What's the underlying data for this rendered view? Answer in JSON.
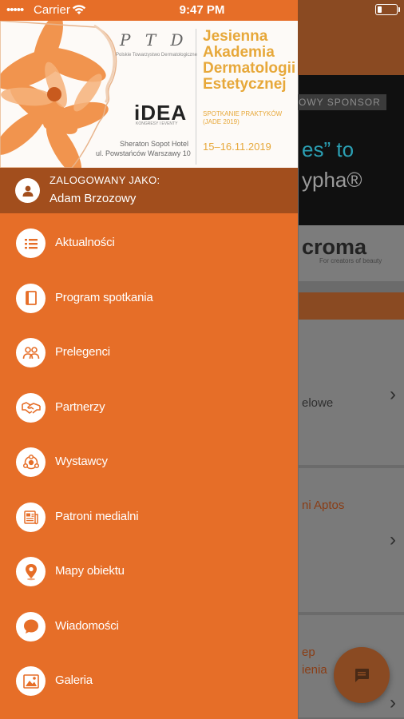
{
  "status_bar": {
    "carrier": "Carrier",
    "time": "9:47 PM",
    "icons": [
      "signal-dots-icon",
      "wifi-icon",
      "battery-icon"
    ]
  },
  "drawer": {
    "promo": {
      "logo_ptd": "P T D",
      "logo_ptd_sub": "Polskie Towarzystwo Dermatologiczne",
      "logo_idea": "iDEA",
      "logo_idea_sub": "KONGRESY I EVENTY",
      "venue_line1": "Sheraton Sopot Hotel",
      "venue_line2": "ul. Powstańców Warszawy 10",
      "event_title": [
        "Jesienna",
        "Akademia",
        "Dermatologii",
        "Estetycznej"
      ],
      "event_subtitle": "SPOTKANIE PRAKTYKÓW (JADE 2019)",
      "event_dates": "15–16.11.2019"
    },
    "user": {
      "label": "ZALOGOWANY JAKO:",
      "name": "Adam Brzozowy"
    },
    "menu": [
      {
        "label": "Aktualności",
        "icon": "list-icon"
      },
      {
        "label": "Program spotkania",
        "icon": "book-icon"
      },
      {
        "label": "Prelegenci",
        "icon": "people-icon"
      },
      {
        "label": "Partnerzy",
        "icon": "handshake-icon"
      },
      {
        "label": "Wystawcy",
        "icon": "network-icon"
      },
      {
        "label": "Patroni medialni",
        "icon": "newspaper-icon"
      },
      {
        "label": "Mapy obiektu",
        "icon": "map-pin-icon"
      },
      {
        "label": "Wiadomości",
        "icon": "chat-bubble-icon"
      },
      {
        "label": "Galeria",
        "icon": "image-icon"
      }
    ]
  },
  "background": {
    "sponsor_badge": "OWY SPONSOR",
    "banner_quote": "es” to",
    "banner_brand": "ypha®",
    "logo_text": "croma",
    "logo_sub": "For creators of beauty",
    "cards": [
      {
        "text": "elowe"
      },
      {
        "text": "ni Aptos"
      },
      {
        "text": "ep"
      },
      {
        "text": "ienia"
      }
    ]
  },
  "colors": {
    "drawer": "#e66e28",
    "user_row": "#a24e1d",
    "accent_gold": "#e7a83a",
    "overlay": "#6b6b6b"
  }
}
